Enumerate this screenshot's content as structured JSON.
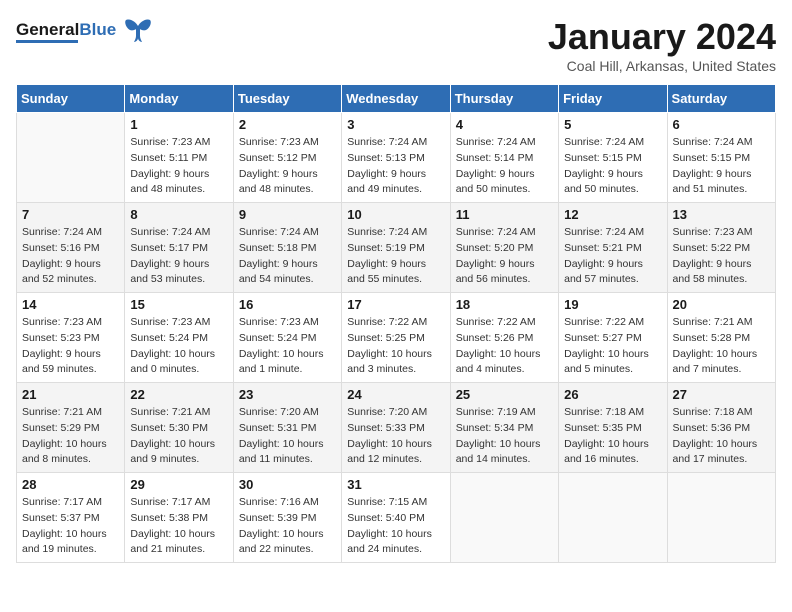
{
  "header": {
    "logo_general": "General",
    "logo_blue": "Blue",
    "month_title": "January 2024",
    "location": "Coal Hill, Arkansas, United States"
  },
  "days_of_week": [
    "Sunday",
    "Monday",
    "Tuesday",
    "Wednesday",
    "Thursday",
    "Friday",
    "Saturday"
  ],
  "weeks": [
    [
      {
        "day": "",
        "empty": true
      },
      {
        "day": "1",
        "sunrise": "Sunrise: 7:23 AM",
        "sunset": "Sunset: 5:11 PM",
        "daylight": "Daylight: 9 hours and 48 minutes."
      },
      {
        "day": "2",
        "sunrise": "Sunrise: 7:23 AM",
        "sunset": "Sunset: 5:12 PM",
        "daylight": "Daylight: 9 hours and 48 minutes."
      },
      {
        "day": "3",
        "sunrise": "Sunrise: 7:24 AM",
        "sunset": "Sunset: 5:13 PM",
        "daylight": "Daylight: 9 hours and 49 minutes."
      },
      {
        "day": "4",
        "sunrise": "Sunrise: 7:24 AM",
        "sunset": "Sunset: 5:14 PM",
        "daylight": "Daylight: 9 hours and 50 minutes."
      },
      {
        "day": "5",
        "sunrise": "Sunrise: 7:24 AM",
        "sunset": "Sunset: 5:15 PM",
        "daylight": "Daylight: 9 hours and 50 minutes."
      },
      {
        "day": "6",
        "sunrise": "Sunrise: 7:24 AM",
        "sunset": "Sunset: 5:15 PM",
        "daylight": "Daylight: 9 hours and 51 minutes."
      }
    ],
    [
      {
        "day": "7",
        "sunrise": "Sunrise: 7:24 AM",
        "sunset": "Sunset: 5:16 PM",
        "daylight": "Daylight: 9 hours and 52 minutes."
      },
      {
        "day": "8",
        "sunrise": "Sunrise: 7:24 AM",
        "sunset": "Sunset: 5:17 PM",
        "daylight": "Daylight: 9 hours and 53 minutes."
      },
      {
        "day": "9",
        "sunrise": "Sunrise: 7:24 AM",
        "sunset": "Sunset: 5:18 PM",
        "daylight": "Daylight: 9 hours and 54 minutes."
      },
      {
        "day": "10",
        "sunrise": "Sunrise: 7:24 AM",
        "sunset": "Sunset: 5:19 PM",
        "daylight": "Daylight: 9 hours and 55 minutes."
      },
      {
        "day": "11",
        "sunrise": "Sunrise: 7:24 AM",
        "sunset": "Sunset: 5:20 PM",
        "daylight": "Daylight: 9 hours and 56 minutes."
      },
      {
        "day": "12",
        "sunrise": "Sunrise: 7:24 AM",
        "sunset": "Sunset: 5:21 PM",
        "daylight": "Daylight: 9 hours and 57 minutes."
      },
      {
        "day": "13",
        "sunrise": "Sunrise: 7:23 AM",
        "sunset": "Sunset: 5:22 PM",
        "daylight": "Daylight: 9 hours and 58 minutes."
      }
    ],
    [
      {
        "day": "14",
        "sunrise": "Sunrise: 7:23 AM",
        "sunset": "Sunset: 5:23 PM",
        "daylight": "Daylight: 9 hours and 59 minutes."
      },
      {
        "day": "15",
        "sunrise": "Sunrise: 7:23 AM",
        "sunset": "Sunset: 5:24 PM",
        "daylight": "Daylight: 10 hours and 0 minutes."
      },
      {
        "day": "16",
        "sunrise": "Sunrise: 7:23 AM",
        "sunset": "Sunset: 5:24 PM",
        "daylight": "Daylight: 10 hours and 1 minute."
      },
      {
        "day": "17",
        "sunrise": "Sunrise: 7:22 AM",
        "sunset": "Sunset: 5:25 PM",
        "daylight": "Daylight: 10 hours and 3 minutes."
      },
      {
        "day": "18",
        "sunrise": "Sunrise: 7:22 AM",
        "sunset": "Sunset: 5:26 PM",
        "daylight": "Daylight: 10 hours and 4 minutes."
      },
      {
        "day": "19",
        "sunrise": "Sunrise: 7:22 AM",
        "sunset": "Sunset: 5:27 PM",
        "daylight": "Daylight: 10 hours and 5 minutes."
      },
      {
        "day": "20",
        "sunrise": "Sunrise: 7:21 AM",
        "sunset": "Sunset: 5:28 PM",
        "daylight": "Daylight: 10 hours and 7 minutes."
      }
    ],
    [
      {
        "day": "21",
        "sunrise": "Sunrise: 7:21 AM",
        "sunset": "Sunset: 5:29 PM",
        "daylight": "Daylight: 10 hours and 8 minutes."
      },
      {
        "day": "22",
        "sunrise": "Sunrise: 7:21 AM",
        "sunset": "Sunset: 5:30 PM",
        "daylight": "Daylight: 10 hours and 9 minutes."
      },
      {
        "day": "23",
        "sunrise": "Sunrise: 7:20 AM",
        "sunset": "Sunset: 5:31 PM",
        "daylight": "Daylight: 10 hours and 11 minutes."
      },
      {
        "day": "24",
        "sunrise": "Sunrise: 7:20 AM",
        "sunset": "Sunset: 5:33 PM",
        "daylight": "Daylight: 10 hours and 12 minutes."
      },
      {
        "day": "25",
        "sunrise": "Sunrise: 7:19 AM",
        "sunset": "Sunset: 5:34 PM",
        "daylight": "Daylight: 10 hours and 14 minutes."
      },
      {
        "day": "26",
        "sunrise": "Sunrise: 7:18 AM",
        "sunset": "Sunset: 5:35 PM",
        "daylight": "Daylight: 10 hours and 16 minutes."
      },
      {
        "day": "27",
        "sunrise": "Sunrise: 7:18 AM",
        "sunset": "Sunset: 5:36 PM",
        "daylight": "Daylight: 10 hours and 17 minutes."
      }
    ],
    [
      {
        "day": "28",
        "sunrise": "Sunrise: 7:17 AM",
        "sunset": "Sunset: 5:37 PM",
        "daylight": "Daylight: 10 hours and 19 minutes."
      },
      {
        "day": "29",
        "sunrise": "Sunrise: 7:17 AM",
        "sunset": "Sunset: 5:38 PM",
        "daylight": "Daylight: 10 hours and 21 minutes."
      },
      {
        "day": "30",
        "sunrise": "Sunrise: 7:16 AM",
        "sunset": "Sunset: 5:39 PM",
        "daylight": "Daylight: 10 hours and 22 minutes."
      },
      {
        "day": "31",
        "sunrise": "Sunrise: 7:15 AM",
        "sunset": "Sunset: 5:40 PM",
        "daylight": "Daylight: 10 hours and 24 minutes."
      },
      {
        "day": "",
        "empty": true
      },
      {
        "day": "",
        "empty": true
      },
      {
        "day": "",
        "empty": true
      }
    ]
  ]
}
